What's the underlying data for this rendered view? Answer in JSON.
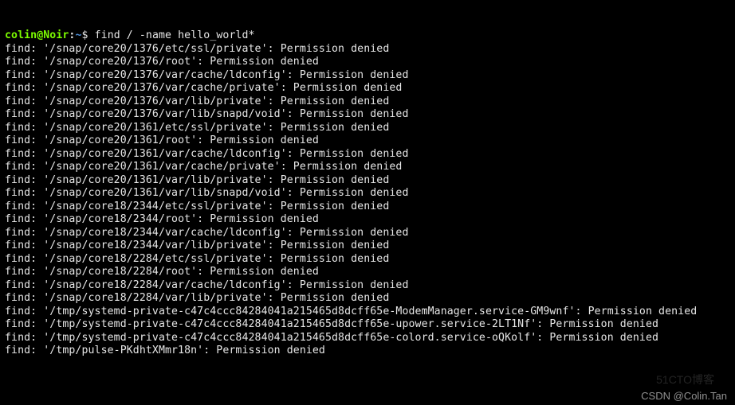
{
  "prompt": {
    "user": "colin",
    "host": "Noir",
    "path": "~",
    "symbol": "$"
  },
  "command": "find / -name hello_world*",
  "output_lines": [
    "find: '/snap/core20/1376/etc/ssl/private': Permission denied",
    "find: '/snap/core20/1376/root': Permission denied",
    "find: '/snap/core20/1376/var/cache/ldconfig': Permission denied",
    "find: '/snap/core20/1376/var/cache/private': Permission denied",
    "find: '/snap/core20/1376/var/lib/private': Permission denied",
    "find: '/snap/core20/1376/var/lib/snapd/void': Permission denied",
    "find: '/snap/core20/1361/etc/ssl/private': Permission denied",
    "find: '/snap/core20/1361/root': Permission denied",
    "find: '/snap/core20/1361/var/cache/ldconfig': Permission denied",
    "find: '/snap/core20/1361/var/cache/private': Permission denied",
    "find: '/snap/core20/1361/var/lib/private': Permission denied",
    "find: '/snap/core20/1361/var/lib/snapd/void': Permission denied",
    "find: '/snap/core18/2344/etc/ssl/private': Permission denied",
    "find: '/snap/core18/2344/root': Permission denied",
    "find: '/snap/core18/2344/var/cache/ldconfig': Permission denied",
    "find: '/snap/core18/2344/var/lib/private': Permission denied",
    "find: '/snap/core18/2284/etc/ssl/private': Permission denied",
    "find: '/snap/core18/2284/root': Permission denied",
    "find: '/snap/core18/2284/var/cache/ldconfig': Permission denied",
    "find: '/snap/core18/2284/var/lib/private': Permission denied",
    "find: '/tmp/systemd-private-c47c4ccc84284041a215465d8dcff65e-ModemManager.service-GM9wnf': Permission denied",
    "find: '/tmp/systemd-private-c47c4ccc84284041a215465d8dcff65e-upower.service-2LT1Nf': Permission denied",
    "find: '/tmp/systemd-private-c47c4ccc84284041a215465d8dcff65e-colord.service-oQKolf': Permission denied",
    "find: '/tmp/pulse-PKdhtXMmr18n': Permission denied"
  ],
  "watermarks": {
    "site": "51CTO博客",
    "author": "CSDN @Colin.Tan"
  }
}
